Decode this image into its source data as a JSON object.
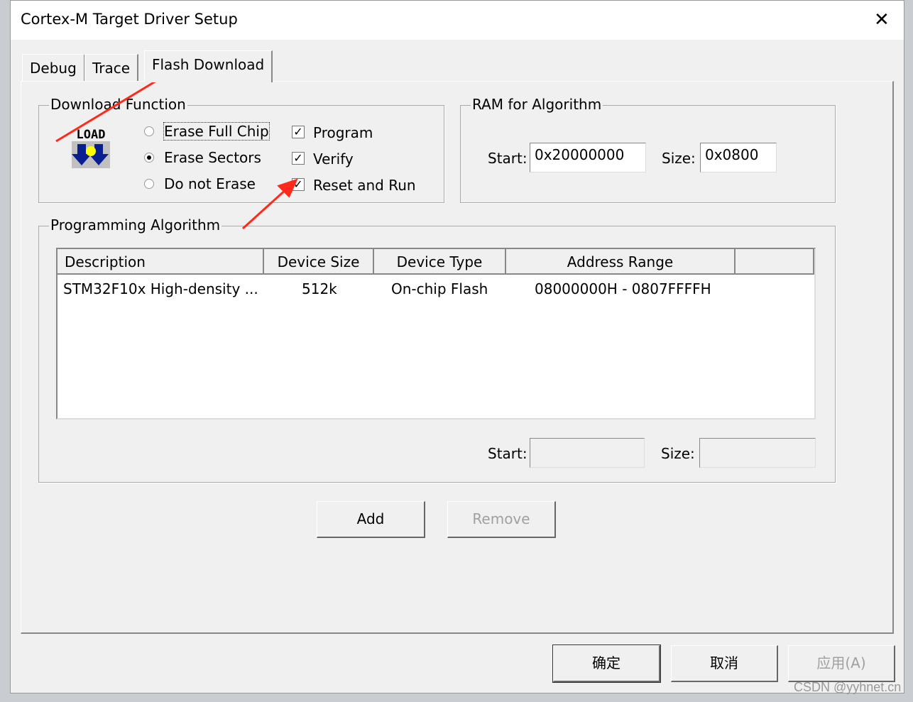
{
  "window": {
    "title": "Cortex-M Target Driver Setup",
    "close_icon": "close-icon"
  },
  "tabs": [
    {
      "label": "Debug"
    },
    {
      "label": "Trace"
    },
    {
      "label": "Flash Download",
      "active": true
    }
  ],
  "download_function": {
    "title": "Download Function",
    "logo_text": "LOAD",
    "erase_options": [
      {
        "label": "Erase Full Chip",
        "selected": false
      },
      {
        "label": "Erase Sectors",
        "selected": true
      },
      {
        "label": "Do not Erase",
        "selected": false
      }
    ],
    "checks": [
      {
        "label": "Program",
        "checked": true
      },
      {
        "label": "Verify",
        "checked": true
      },
      {
        "label": "Reset and Run",
        "checked": true
      }
    ]
  },
  "ram": {
    "title": "RAM for Algorithm",
    "start_label": "Start:",
    "start": "0x20000000",
    "size_label": "Size:",
    "size": "0x0800"
  },
  "algorithm": {
    "title": "Programming Algorithm",
    "columns": [
      "Description",
      "Device Size",
      "Device Type",
      "Address Range"
    ],
    "rows": [
      [
        "STM32F10x High-density ...",
        "512k",
        "On-chip Flash",
        "08000000H - 0807FFFFH"
      ]
    ],
    "start_label": "Start:",
    "start": "",
    "size_label": "Size:",
    "size": ""
  },
  "buttons": {
    "add": "Add",
    "remove": "Remove"
  },
  "footer": {
    "ok": "确定",
    "cancel": "取消",
    "apply": "应用(A)"
  },
  "watermark": "CSDN @yyhnet.cn",
  "annotation_color": "#ff2a1a"
}
